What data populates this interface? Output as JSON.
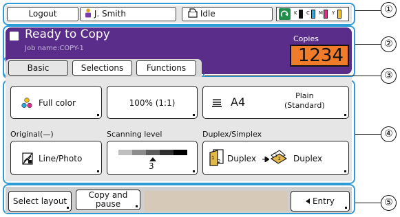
{
  "status_bar": {
    "logout_label": "Logout",
    "user_name": "J. Smith",
    "status_text": "Idle",
    "ink": [
      {
        "letter": "K",
        "color": "#111111"
      },
      {
        "letter": "C",
        "color": "#2aa8e0"
      },
      {
        "letter": "M",
        "color": "#e0308a"
      },
      {
        "letter": "Y",
        "color": "#f2c21b"
      }
    ]
  },
  "header": {
    "title": "Ready to Copy",
    "job_name": "Job name:COPY-1",
    "copies_label": "Copies",
    "copies_value": "1234",
    "accent_color": "#5a2d8a",
    "copies_color": "#f07c2a"
  },
  "tabs": [
    {
      "label": "Basic"
    },
    {
      "label": "Selections"
    },
    {
      "label": "Functions"
    }
  ],
  "settings": {
    "color_mode": "Full color",
    "zoom": "100% (1:1)",
    "paper_size": "A4",
    "paper_type": "Plain\n(Standard)",
    "original_label": "Original(—)",
    "original_value": "Line/Photo",
    "scan_label": "Scanning level",
    "scan_value": "3",
    "duplex_label": "Duplex/Simplex",
    "duplex_from": "Duplex",
    "duplex_to": "Duplex"
  },
  "footer": {
    "select_layout": "Select layout",
    "copy_pause": "Copy and\npause",
    "entry": "Entry"
  },
  "callouts": [
    "①",
    "②",
    "③",
    "④",
    "⑤"
  ]
}
